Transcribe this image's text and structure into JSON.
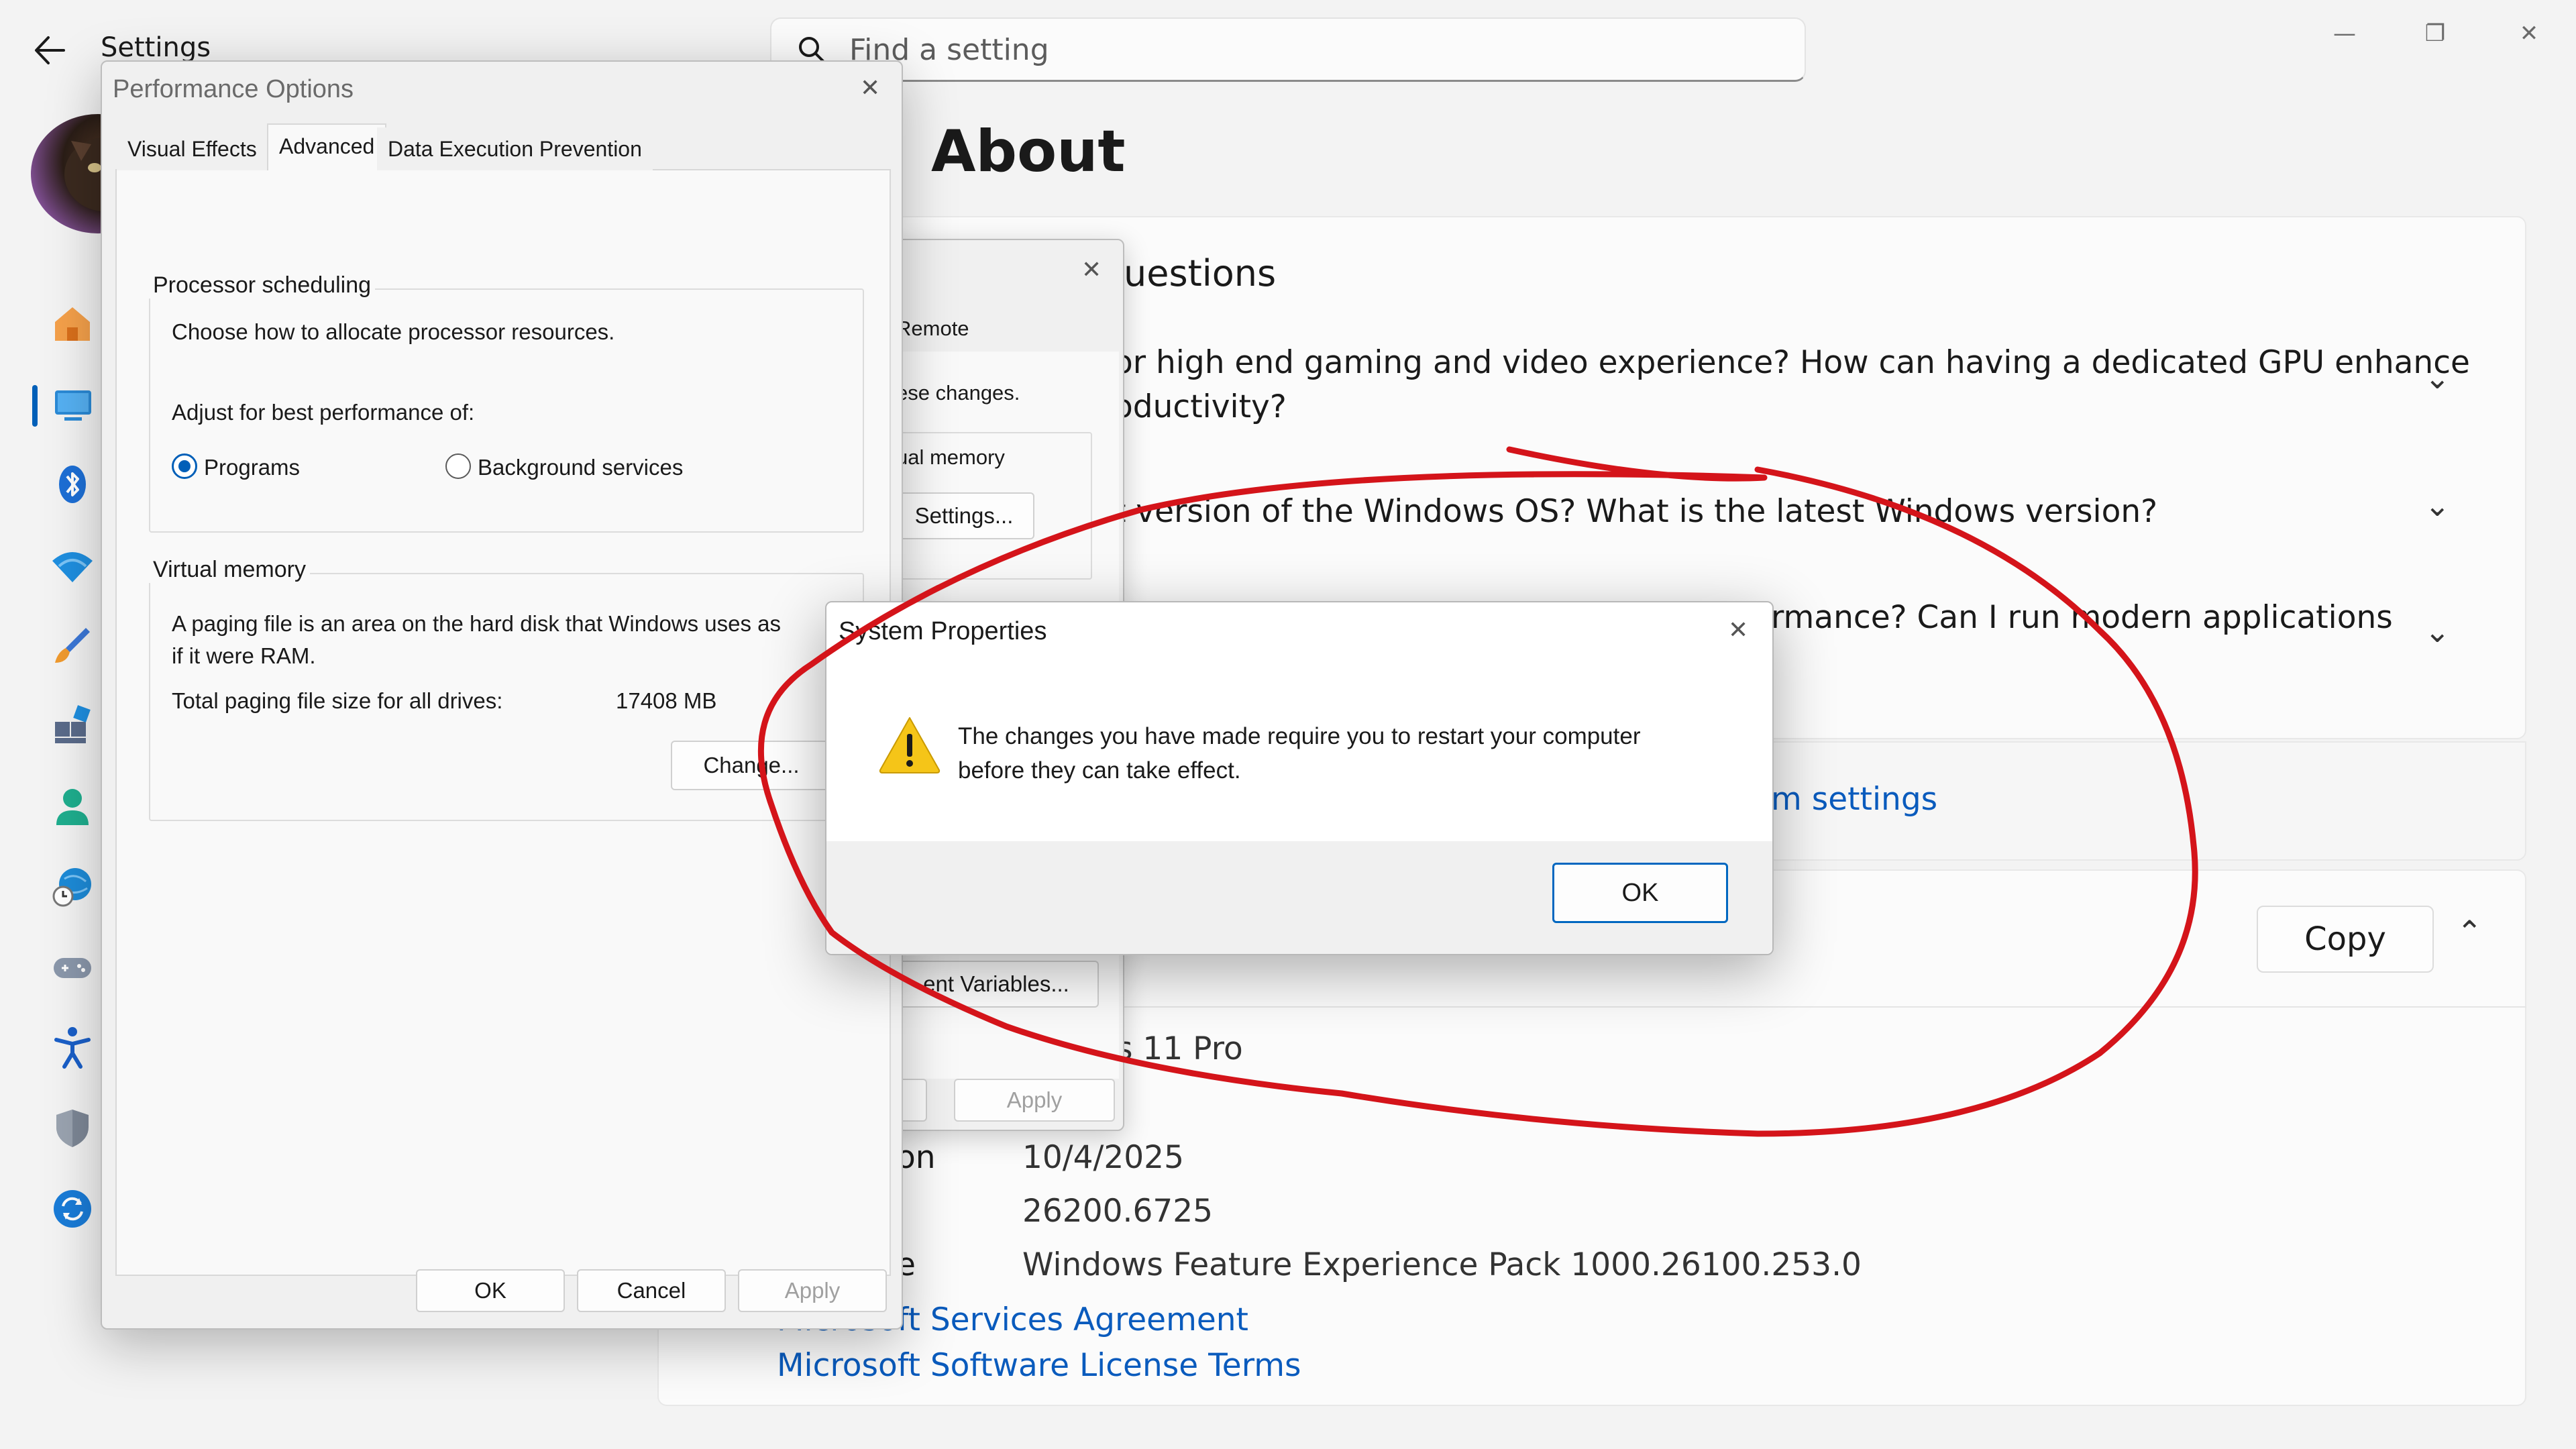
{
  "window": {
    "title": "Settings",
    "back_icon": "arrow-left-icon",
    "minimize_glyph": "—",
    "restore_glyph": "❐",
    "close_glyph": "✕"
  },
  "search": {
    "placeholder": "Find a setting"
  },
  "sidebar": {
    "items": [
      {
        "icon": "home-icon"
      },
      {
        "icon": "system-icon"
      },
      {
        "icon": "bluetooth-icon"
      },
      {
        "icon": "wifi-icon"
      },
      {
        "icon": "personalization-brush-icon"
      },
      {
        "icon": "apps-icon"
      },
      {
        "icon": "accounts-icon"
      },
      {
        "icon": "time-language-icon"
      },
      {
        "icon": "gaming-icon"
      },
      {
        "icon": "accessibility-icon"
      },
      {
        "icon": "privacy-shield-icon"
      },
      {
        "icon": "windows-update-icon"
      }
    ],
    "accent": "#005fb8"
  },
  "main": {
    "page_title": "About",
    "faq": {
      "header": "uestions",
      "questions": [
        {
          "line1": "or high end gaming and video experience? How can having a dedicated GPU enhance",
          "line2": "oductivity?"
        },
        {
          "line1": "t version of the Windows OS? What is the latest Windows version?"
        },
        {
          "line1": "rmance?  Can I run  modern  applications"
        }
      ],
      "chevron": "⌄"
    },
    "related_link": "m settings",
    "specs": {
      "copy_label": "Copy",
      "collapse_glyph": "⌃",
      "edition_value": "s 11 Pro",
      "rows": [
        {
          "label": "on",
          "value": "10/4/2025"
        },
        {
          "label": "",
          "value": "26200.6725"
        },
        {
          "label": "e",
          "value": "Windows Feature Experience Pack 1000.26100.253.0"
        }
      ],
      "links": [
        "Microsoft Services Agreement",
        "Microsoft Software License Terms"
      ]
    }
  },
  "sysprops_bg": {
    "close_glyph": "✕",
    "tab_remote": "Remote",
    "text_changes": "ese changes.",
    "group_virtual": "ual memory",
    "settings_button": "Settings...",
    "env_button": "ent Variables...",
    "apply_button": "Apply"
  },
  "perf_options": {
    "title": "Performance Options",
    "close_glyph": "✕",
    "tabs": [
      "Visual Effects",
      "Advanced",
      "Data Execution Prevention"
    ],
    "active_tab": "Advanced",
    "processor": {
      "group_title": "Processor scheduling",
      "description": "Choose how to allocate processor resources.",
      "adjust_label": "Adjust for best performance of:",
      "option_programs": "Programs",
      "option_background": "Background services",
      "selected": "Programs"
    },
    "virtual_memory": {
      "group_title": "Virtual memory",
      "description_line1": "A paging file is an area on the hard disk that Windows uses as",
      "description_line2": "if it were RAM.",
      "total_label": "Total paging file size for all drives:",
      "total_value": "17408 MB",
      "change_button": "Change..."
    },
    "buttons": {
      "ok": "OK",
      "cancel": "Cancel",
      "apply": "Apply"
    }
  },
  "alert": {
    "title": "System Properties",
    "close_glyph": "✕",
    "icon": "warning-icon",
    "message_line1": "The changes you have made require you to restart your computer",
    "message_line2": "before they can take effect.",
    "ok_label": "OK"
  },
  "annotation": {
    "color": "#d4141a"
  }
}
